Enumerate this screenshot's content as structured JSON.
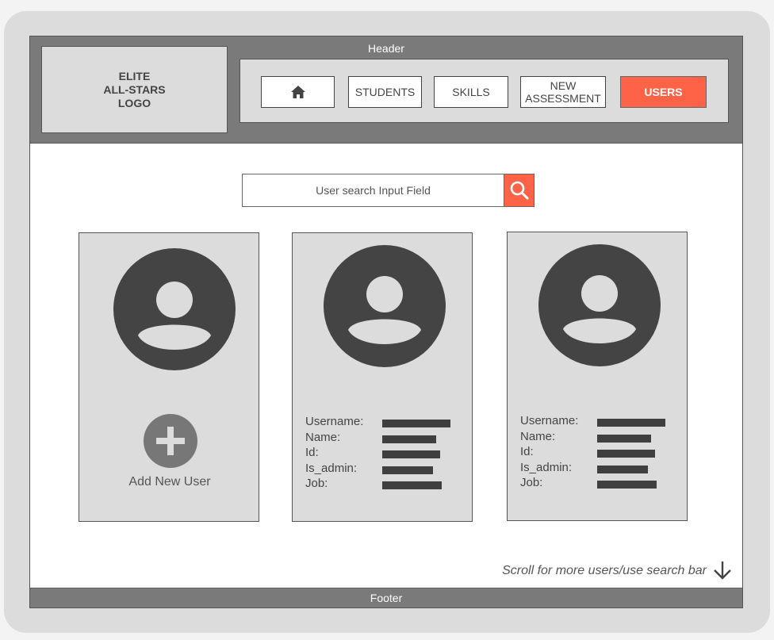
{
  "header": {
    "title": "Header",
    "logo_text": "ELITE\nALL-STARS\nLOGO"
  },
  "nav": {
    "home_icon": "home-icon",
    "items": [
      {
        "label": "STUDENTS"
      },
      {
        "label": "SKILLS"
      },
      {
        "label": "NEW\nASSESSMENT"
      },
      {
        "label": "USERS"
      }
    ],
    "active": "USERS"
  },
  "search": {
    "placeholder": "User search Input Field",
    "icon": "search-icon"
  },
  "add_user": {
    "label": "Add New User",
    "icon": "plus-icon"
  },
  "user_cards": [
    {
      "fields": [
        {
          "label": "Username:"
        },
        {
          "label": "Name:"
        },
        {
          "label": "Id:"
        },
        {
          "label": "Is_admin:"
        },
        {
          "label": "Job:"
        }
      ]
    },
    {
      "fields": [
        {
          "label": "Username:"
        },
        {
          "label": "Name:"
        },
        {
          "label": "Id:"
        },
        {
          "label": "Is_admin:"
        },
        {
          "label": "Job:"
        }
      ]
    }
  ],
  "scroll_hint": "Scroll for more users/use search bar",
  "footer": {
    "title": "Footer"
  },
  "colors": {
    "accent": "#ff6347",
    "chrome": "#7a7a7a",
    "panel": "#dcdcdc",
    "dark": "#444444"
  }
}
